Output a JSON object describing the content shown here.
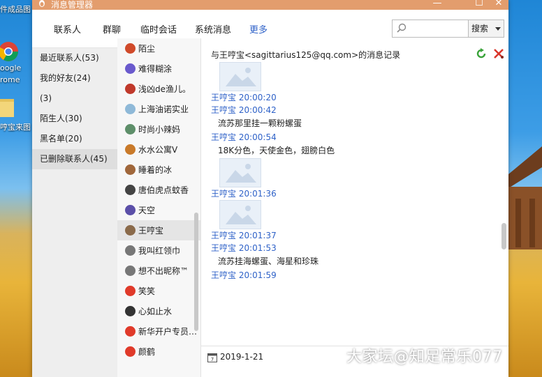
{
  "desktop": {
    "label_top": "件成品图",
    "label_google1": "oogle",
    "label_google2": "rome",
    "label_folder": "哼宝来图",
    "watermark": "大家坛@知足常乐077"
  },
  "window": {
    "title": "消息管理器",
    "minimize": "—",
    "maximize": "☐",
    "close": "✕"
  },
  "toolbar": {
    "tabs": [
      "联系人",
      "群聊",
      "临时会话",
      "系统消息",
      "更多"
    ],
    "search_placeholder": "",
    "search_button": "搜索"
  },
  "sidebar": {
    "items": [
      {
        "label": "最近联系人(53)"
      },
      {
        "label": "我的好友(24)"
      },
      {
        "label": "(3)"
      },
      {
        "label": "陌生人(30)"
      },
      {
        "label": "黑名单(20)"
      },
      {
        "label": "已删除联系人(45)"
      }
    ]
  },
  "contacts": {
    "items": [
      {
        "name": "陌尘",
        "color": "#d04a2a"
      },
      {
        "name": "难得糊涂",
        "color": "#6a5acd"
      },
      {
        "name": "浅凶de渔儿。",
        "color": "#c0392b"
      },
      {
        "name": "上海油诺实业",
        "color": "#8fb9d8"
      },
      {
        "name": "时尚小辣妈",
        "color": "#5e8f6a"
      },
      {
        "name": "水水公寓V",
        "color": "#c97a2a"
      },
      {
        "name": "睡着的冰",
        "color": "#a0673b"
      },
      {
        "name": "唐伯虎点蚊香",
        "color": "#444444"
      },
      {
        "name": "天空",
        "color": "#5b4fa8"
      },
      {
        "name": "王哼宝",
        "color": "#8a6a4a"
      },
      {
        "name": "我叫红领巾",
        "color": "#777777"
      },
      {
        "name": "想不出昵称™",
        "color": "#777777"
      },
      {
        "name": "笑笑",
        "color": "#e03a2a"
      },
      {
        "name": "心如止水",
        "color": "#333333"
      },
      {
        "name": "新华开户专员…",
        "color": "#e03a2a"
      },
      {
        "name": "颜鹤",
        "color": "#e03a2a"
      }
    ]
  },
  "messages": {
    "header": "与王哼宝<sagittarius125@qq.com>的消息记录",
    "items": [
      {
        "sender": "王哼宝 20:00:20",
        "image": true,
        "text": ""
      },
      {
        "sender": "王哼宝 20:00:42",
        "image": false,
        "text": "流苏那里挂一颗粉螺蛋"
      },
      {
        "sender": "王哼宝 20:00:54",
        "image": false,
        "text": "18K分色，天使金色，翅膀白色"
      },
      {
        "sender": "王哼宝 20:01:36",
        "image": true,
        "text": ""
      },
      {
        "sender": "王哼宝 20:01:37",
        "image": true,
        "text": ""
      },
      {
        "sender": "王哼宝 20:01:53",
        "image": false,
        "text": "流苏挂海螺蛋、海星和珍珠"
      },
      {
        "sender": "王哼宝 20:01:59",
        "image": false,
        "text": ""
      }
    ],
    "date": "2019-1-21"
  }
}
